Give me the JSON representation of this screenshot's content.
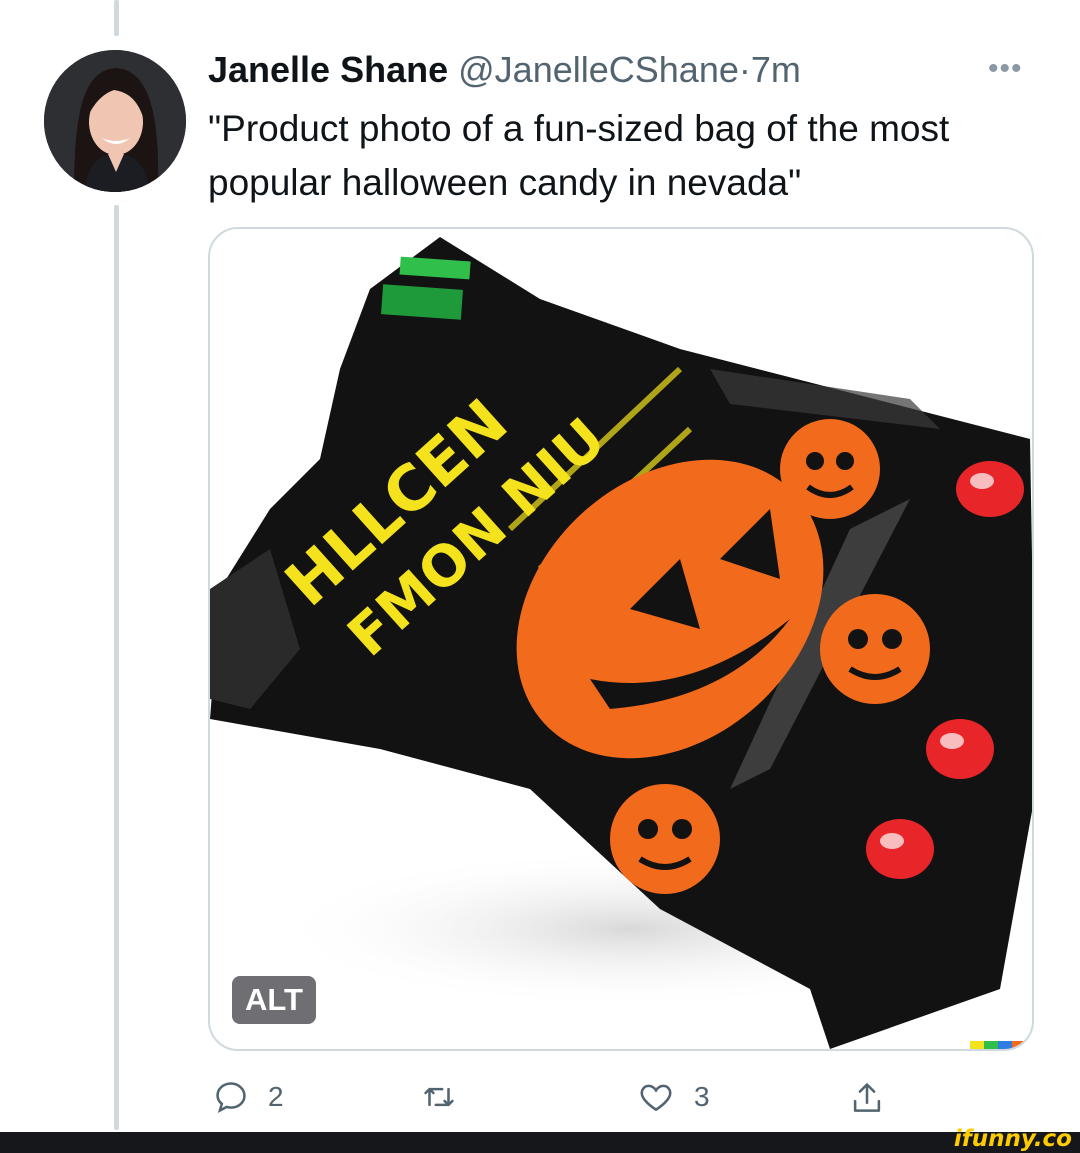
{
  "tweet": {
    "author_name": "Janelle Shane",
    "handle": "@JanelleCShane",
    "separator": "·",
    "time": "7m",
    "more_label": "•••",
    "text": "\"Product photo of a fun-sized bag of the most popular halloween candy in nevada\""
  },
  "media": {
    "alt_badge": "ALT",
    "package_text_top": "HLLCEN",
    "package_text_mid": "FMON NIU"
  },
  "actions": {
    "replies": "2",
    "likes": "3"
  },
  "footer": {
    "watermark": "ifunny.co"
  },
  "colors": {
    "text_primary": "#0f1419",
    "text_secondary": "#536471",
    "border": "#cfd9de",
    "bag_black": "#121212",
    "pumpkin_orange": "#f26a1b",
    "label_yellow": "#f4e21c"
  }
}
